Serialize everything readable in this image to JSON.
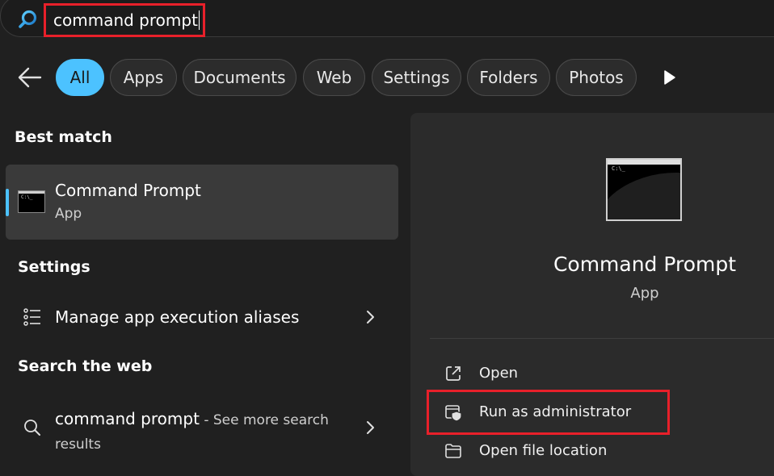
{
  "search": {
    "query": "command prompt"
  },
  "filters": {
    "chips": [
      "All",
      "Apps",
      "Documents",
      "Web",
      "Settings",
      "Folders",
      "Photos"
    ]
  },
  "best_match": {
    "header": "Best match",
    "title": "Command Prompt",
    "subtitle": "App"
  },
  "settings": {
    "header": "Settings",
    "item_label": "Manage app execution aliases"
  },
  "web": {
    "header": "Search the web",
    "query": "command prompt",
    "suffix_line1": " - See more search",
    "suffix_line2": "results"
  },
  "details": {
    "title": "Command Prompt",
    "subtitle": "App",
    "actions": [
      "Open",
      "Run as administrator",
      "Open file location"
    ]
  },
  "colors": {
    "accent": "#4cc2ff",
    "highlight_box": "#e8202a",
    "background": "#202020",
    "right_pane": "#2b2b2b"
  },
  "icons": {
    "search": "search-icon",
    "back": "back-arrow-icon",
    "more": "play-triangle-icon",
    "app": "command-prompt-icon",
    "settings": "list-icon",
    "chevron": "chevron-right-icon",
    "web_search": "magnifier-icon",
    "open": "open-external-icon",
    "run_admin": "shield-window-icon",
    "open_location": "folder-icon"
  }
}
